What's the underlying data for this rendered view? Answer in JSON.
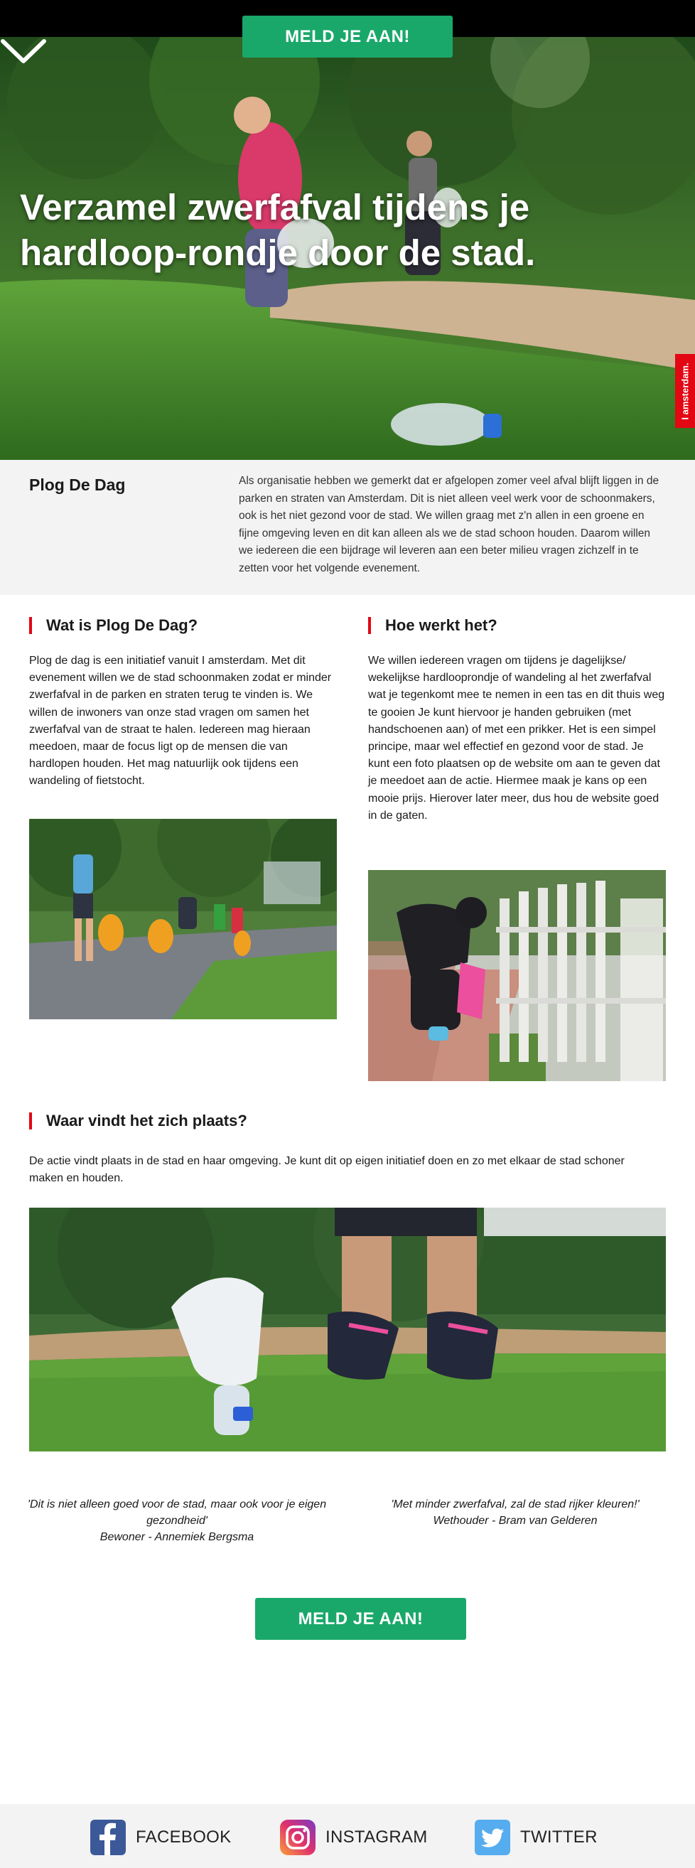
{
  "header": {
    "cta_label": "MELD JE AAN!"
  },
  "hero": {
    "title": "Verzamel zwerfafval tijdens je hardloop-rondje door de stad.",
    "badge": "I amsterdam.",
    "scroll_icon": "chevron-down-icon"
  },
  "intro": {
    "title": "Plog De Dag",
    "text": "Als organisatie hebben we gemerkt dat er afgelopen zomer veel afval blijft liggen in de parken en straten van Amsterdam. Dit is niet alleen veel werk voor de schoonmakers, ook is het niet gezond voor de stad. We willen graag met z'n allen in een groene en fijne omgeving leven en dit kan alleen als we de stad schoon houden. Daarom willen we iedereen die een bijdrage wil leveren aan een beter milieu vragen zichzelf in te zetten voor het volgende evenement."
  },
  "what": {
    "title": "Wat is Plog De Dag?",
    "text": "Plog de dag is een initiatief vanuit I amsterdam. Met dit evenement willen we de stad schoonmaken zodat er minder zwerfafval in de parken en straten terug te vinden is. We willen de inwoners van onze stad vragen om samen het zwerfafval van de straat te halen. Iedereen mag hieraan meedoen, maar de focus ligt op de mensen die van hardlopen houden. Het mag natuurlijk ook tijdens een wandeling of fietstocht."
  },
  "how": {
    "title": "Hoe werkt het?",
    "text": "We willen iedereen vragen om tijdens je dagelijkse/ wekelijkse hardlooprondje of wandeling al het zwerfafval wat je tegenkomt mee te nemen in een tas en dit thuis weg te gooien Je kunt hiervoor je handen gebruiken (met handschoenen aan) of met een prikker. Het is een simpel principe, maar wel effectief en gezond voor de stad. Je kunt een foto plaatsen op de website om aan te geven dat je meedoet aan de actie. Hiermee maak je kans op een mooie prijs. Hierover later meer, dus hou de website goed in de gaten."
  },
  "where": {
    "title": "Waar vindt het zich plaats?",
    "text": "De actie vindt plaats in de stad en haar omgeving. Je kunt dit op eigen initiatief doen en zo met elkaar de stad schoner maken en houden."
  },
  "quotes": [
    {
      "text": "'Dit is niet alleen goed voor de stad, maar ook voor je eigen gezondheid'",
      "author": "Bewoner - Annemiek Bergsma"
    },
    {
      "text": "'Met minder zwerfafval, zal de stad rijker kleuren!'",
      "author": "Wethouder - Bram van Gelderen"
    }
  ],
  "bottom_cta": {
    "label": "MELD JE AAN!"
  },
  "footer": {
    "facebook": "FACEBOOK",
    "instagram": "INSTAGRAM",
    "twitter": "TWITTER"
  },
  "colors": {
    "accent_green": "#1aa86a",
    "brand_red": "#e30613",
    "facebook_blue": "#3b5998",
    "twitter_blue": "#55acee"
  }
}
